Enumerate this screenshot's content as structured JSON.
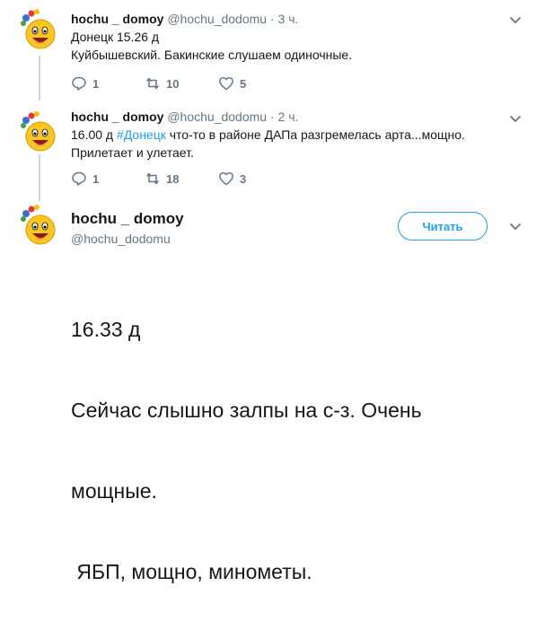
{
  "tweets": [
    {
      "name": "hochu _ domoy",
      "handle": "@hochu_dodomu",
      "dot": "·",
      "time": "3 ч.",
      "text_lines": [
        "Донецк 15.26 д",
        "Куйбышевский. Бакинские слушаем одиночные."
      ],
      "reply_count": "1",
      "retweet_count": "10",
      "like_count": "5"
    },
    {
      "name": "hochu _ domoy",
      "handle": "@hochu_dodomu",
      "dot": "·",
      "time": "2 ч.",
      "text_prefix": "16.00 д ",
      "hashtag": "#Донецк",
      "text_suffix": " что-то в районе ДАПа разгремелась арта...мощно.",
      "text_line2": "Прилетает и улетает.",
      "reply_count": "1",
      "retweet_count": "18",
      "like_count": "3"
    }
  ],
  "main_tweet": {
    "name": "hochu _ domoy",
    "handle": "@hochu_dodomu",
    "follow_label": "Читать",
    "text_lines": [
      "16.33 д",
      "Сейчас слышно залпы на с-з. Очень",
      "мощные.",
      " ЯБП, мощно, минометы."
    ]
  },
  "colors": {
    "accent": "#1da1f2",
    "muted": "#657786",
    "thread_line": "#ccd6dd"
  },
  "icons": [
    "emoji-avatar-icon",
    "reply-icon",
    "retweet-icon",
    "like-icon",
    "chevron-down-icon"
  ]
}
